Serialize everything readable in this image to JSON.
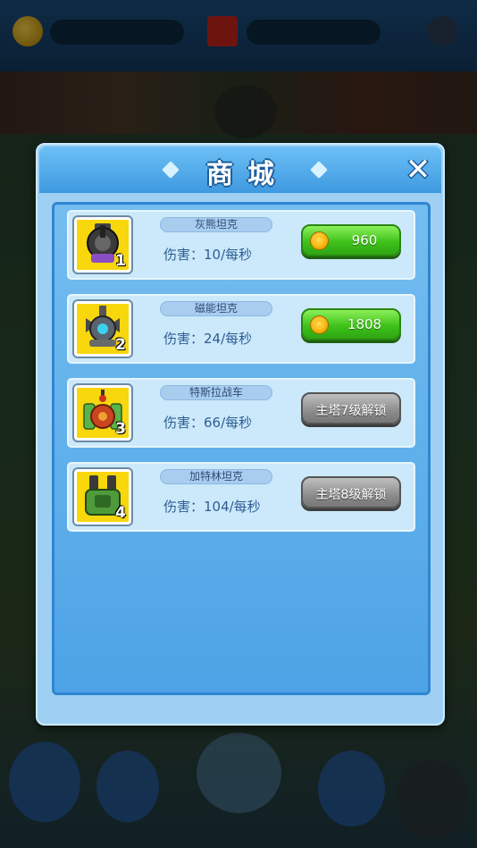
{
  "dialog": {
    "title": "商城",
    "close_label": "✕"
  },
  "items": [
    {
      "name": "灰熊坦克",
      "level": "1",
      "damage": "伤害：10/每秒",
      "price": "960",
      "locked_text": ""
    },
    {
      "name": "磁能坦克",
      "level": "2",
      "damage": "伤害：24/每秒",
      "price": "1808",
      "locked_text": ""
    },
    {
      "name": "特斯拉战车",
      "level": "3",
      "damage": "伤害：66/每秒",
      "price": "",
      "locked_text": "主塔7级解锁"
    },
    {
      "name": "加特林坦克",
      "level": "4",
      "damage": "伤害：104/每秒",
      "price": "",
      "locked_text": "主塔8级解锁"
    }
  ],
  "colors": {
    "accent": "#3f99e0",
    "buy_button": "#3fc21a",
    "locked_button": "#8c8c8c",
    "thumb_background": "#f8d70d"
  },
  "icons": [
    "coin-icon",
    "close-icon",
    "tank-icon"
  ]
}
